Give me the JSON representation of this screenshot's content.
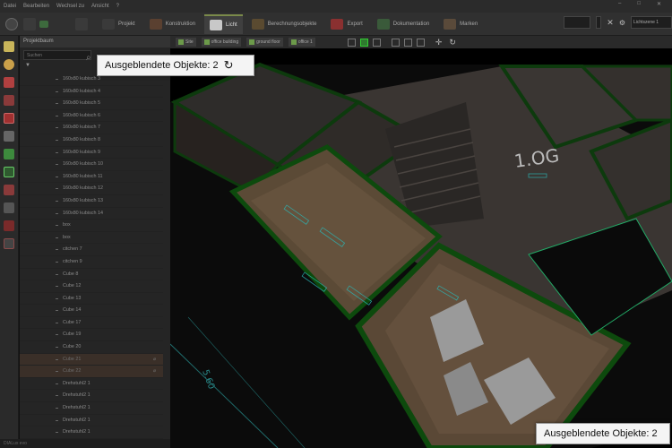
{
  "menu": {
    "items": [
      "Datei",
      "Bearbeiten",
      "Wechsel zu",
      "Ansicht",
      "?"
    ],
    "window_controls": [
      "–",
      "□",
      "✕"
    ]
  },
  "toolbar": {
    "tabs": [
      {
        "label": "Projekt",
        "icon": "project-icon"
      },
      {
        "label": "Konstruktion",
        "icon": "construction-icon"
      },
      {
        "label": "Licht",
        "icon": "light-icon",
        "active": true
      },
      {
        "label": "Berechnungsobjekte",
        "icon": "calculation-objects-icon"
      },
      {
        "label": "Export",
        "icon": "export-icon"
      },
      {
        "label": "Dokumentation",
        "icon": "documentation-icon"
      },
      {
        "label": "Marken",
        "icon": "marks-icon"
      }
    ],
    "light_scene_select": "Lichtszene 1"
  },
  "project_tree": {
    "title": "Projektbaum",
    "search_placeholder": "Suchen",
    "items": [
      {
        "label": "160x80 kubisch 3"
      },
      {
        "label": "160x80 kubisch 4"
      },
      {
        "label": "160x80 kubisch 5"
      },
      {
        "label": "160x80 kubisch 6"
      },
      {
        "label": "160x80 kubisch 7"
      },
      {
        "label": "160x80 kubisch 8"
      },
      {
        "label": "160x80 kubisch 9"
      },
      {
        "label": "160x80 kubisch 10"
      },
      {
        "label": "160x80 kubisch 11"
      },
      {
        "label": "160x80 kubisch 12"
      },
      {
        "label": "160x80 kubisch 13"
      },
      {
        "label": "160x80 kubisch 14"
      },
      {
        "label": "box"
      },
      {
        "label": "box"
      },
      {
        "label": "citchen 7"
      },
      {
        "label": "citchen 9"
      },
      {
        "label": "Cube 8"
      },
      {
        "label": "Cube 12"
      },
      {
        "label": "Cube 13"
      },
      {
        "label": "Cube 14"
      },
      {
        "label": "Cube 17"
      },
      {
        "label": "Cube 19"
      },
      {
        "label": "Cube 20"
      },
      {
        "label": "Cube 21",
        "hidden": true,
        "badge": "⌀"
      },
      {
        "label": "Cube 22",
        "hidden": true,
        "badge": "⌀"
      },
      {
        "label": "Drehstuhl2 1"
      },
      {
        "label": "Drehstuhl2 1"
      },
      {
        "label": "Drehstuhl2 1"
      },
      {
        "label": "Drehstuhl2 1"
      },
      {
        "label": "Drehstuhl2 1"
      }
    ]
  },
  "status_bar": "DIALux evo",
  "viewport": {
    "breadcrumbs": [
      "Site",
      "office building",
      "ground floor",
      "office 1"
    ],
    "floor_label": "1.OG",
    "dimension_label": "5.60"
  },
  "tooltips": {
    "top_text": "Ausgeblendete Objekte: 2",
    "bottom_text": "Ausgeblendete Objekte: 2"
  },
  "colors": {
    "background": "#111111",
    "panel": "#252525",
    "toolbar": "#303030",
    "accent_green": "#2f7a2f",
    "hidden_item": "#3a2f28"
  }
}
